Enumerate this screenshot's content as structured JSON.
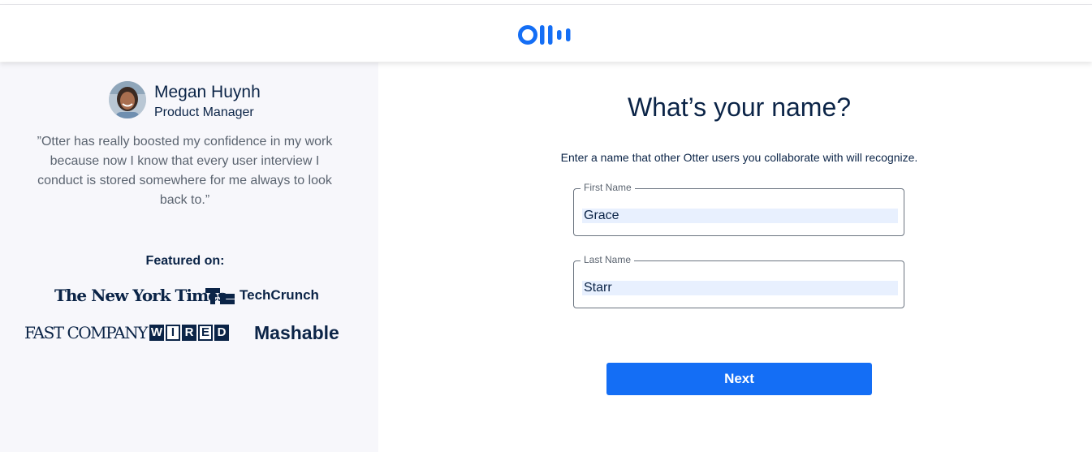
{
  "brand": {
    "logo_icon": "otter-logo-icon",
    "accent_color": "#146ef5",
    "text_color": "#0b2447"
  },
  "testimonial": {
    "name": "Megan Huynh",
    "title": "Product Manager",
    "quote": "”Otter has really boosted my confidence in my work because now I know that every user interview I conduct is stored somewhere for me always to look back to.”"
  },
  "featured": {
    "label": "Featured on:",
    "outlets": [
      "The New York Times",
      "TechCrunch",
      "FAST COMPANY",
      "WIRED",
      "Mashable"
    ]
  },
  "form": {
    "heading": "What’s your name?",
    "subheading": "Enter a name that other Otter users you collaborate with will recognize.",
    "first_name": {
      "label": "First Name",
      "value": "Grace"
    },
    "last_name": {
      "label": "Last Name",
      "value": "Starr"
    },
    "next_label": "Next"
  }
}
